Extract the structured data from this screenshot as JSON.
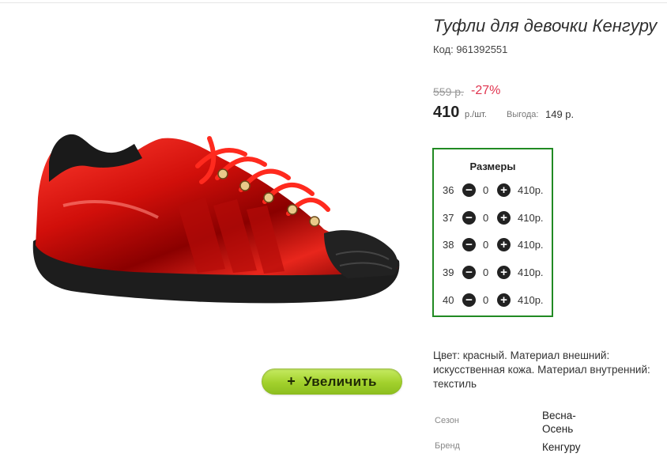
{
  "product": {
    "title": "Туфли для девочки Кенгуру",
    "code": "Код: 961392551",
    "old_price": "559 р.",
    "discount": "-27%",
    "price": "410",
    "price_unit": "р./шт.",
    "benefit_label": "Выгода:",
    "benefit_value": "149 р."
  },
  "sizes": {
    "title": "Размеры",
    "rows": [
      {
        "size": "36",
        "qty": "0",
        "price": "410р."
      },
      {
        "size": "37",
        "qty": "0",
        "price": "410р."
      },
      {
        "size": "38",
        "qty": "0",
        "price": "410р."
      },
      {
        "size": "39",
        "qty": "0",
        "price": "410р."
      },
      {
        "size": "40",
        "qty": "0",
        "price": "410р."
      }
    ],
    "minus_icon": "minus-circle-icon",
    "plus_icon": "plus-circle-icon"
  },
  "zoom_button": {
    "icon": "+",
    "label": "Увеличить"
  },
  "description": "Цвет: красный. Материал внешний: искусственная кожа. Материал внутренний: текстиль",
  "attributes": {
    "season_label": "Сезон",
    "season_value": "Весна-Осень",
    "brand_label": "Бренд",
    "brand_value": "Кенгуру"
  },
  "colors": {
    "sizes_border": "#218a23",
    "discount": "#e0344f",
    "button_green": "#a2d12c"
  }
}
